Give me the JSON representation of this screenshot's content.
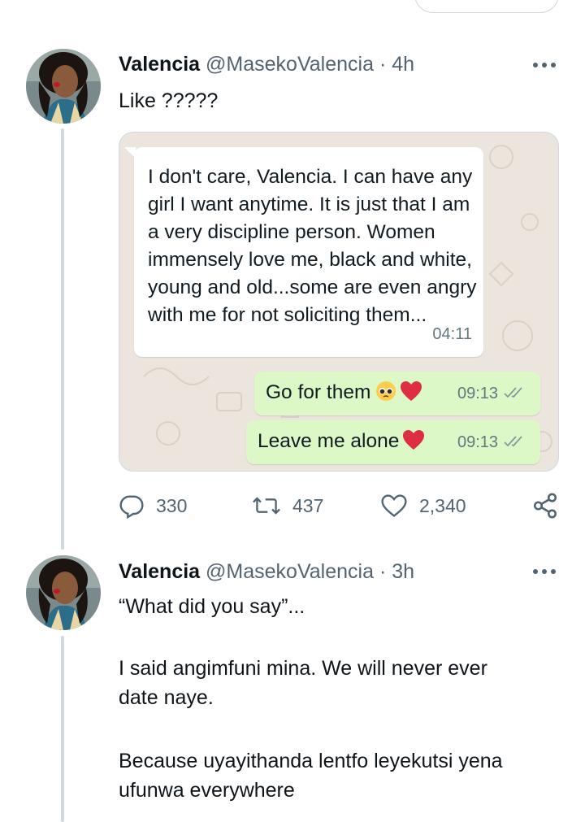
{
  "tweets": [
    {
      "name": "Valencia",
      "handle": "@MasekoValencia",
      "separator": "·",
      "time": "4h",
      "text": "Like ?????",
      "media": {
        "incoming": {
          "text": "I don't care, Valencia. I can have any girl I want anytime. It is just that I am a very discipline person. Women immensely love me, black and white, young and old...some are even angry with me for not soliciting them...",
          "time": "04:11"
        },
        "outgoing": [
          {
            "text": "Go for them",
            "emoji": [
              "pleading-face",
              "red-heart"
            ],
            "time": "09:13"
          },
          {
            "text": "Leave me alone",
            "emoji": [
              "red-heart"
            ],
            "time": "09:13"
          }
        ]
      },
      "actions": {
        "replies": "330",
        "retweets": "437",
        "likes": "2,340"
      }
    },
    {
      "name": "Valencia",
      "handle": "@MasekoValencia",
      "separator": "·",
      "time": "3h",
      "paragraphs": [
        "“What did you say”...",
        "I said angimfuni mina. We will never ever",
        "date naye.",
        "Because uyayithanda lentfo leyekutsi yena",
        "ufunwa everywhere"
      ]
    }
  ],
  "colors": {
    "text": "#0f1419",
    "secondary": "#536471",
    "border": "#cfd9de",
    "incoming_bubble": "#ffffff",
    "outgoing_bubble": "#dcf8c6",
    "chat_background": "#ece5dd",
    "heart": "#dd2e44"
  }
}
